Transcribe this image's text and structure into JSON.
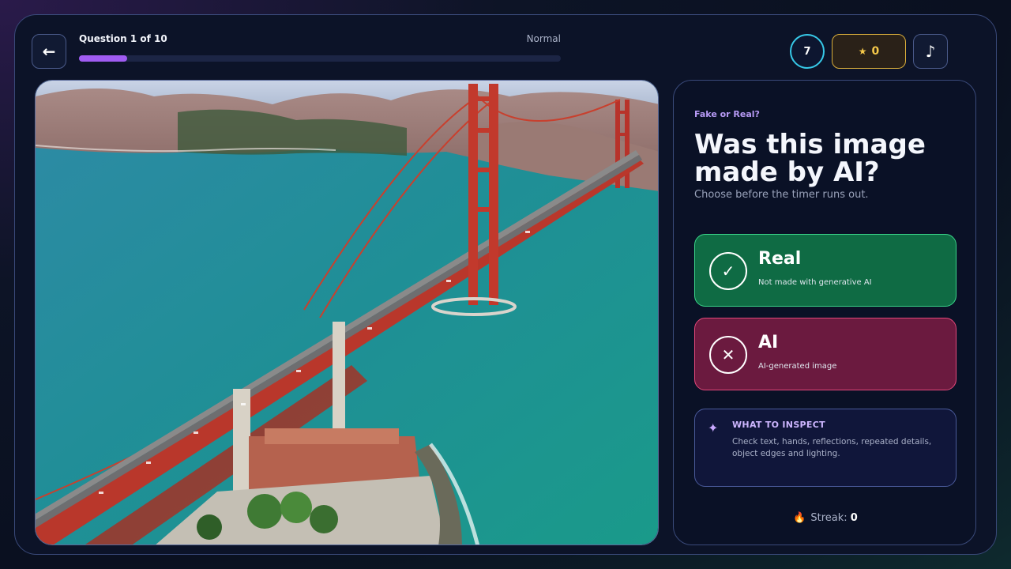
{
  "header": {
    "back_icon": "arrow-left-icon",
    "question_label": "Question 1 of 10",
    "difficulty": "Normal",
    "progress": 0.1,
    "timer": "7",
    "score_icon": "star-icon",
    "score": "0",
    "music_icon": "music-note-icon"
  },
  "image": {
    "subject": "aerial photo of a red suspension bridge over turquoise water"
  },
  "panel": {
    "eyebrow": "Fake or Real?",
    "headline": "Was this image made by AI?",
    "subline": "Choose before the timer runs out.",
    "choices": [
      {
        "title": "Real",
        "desc": "Not made with generative AI",
        "icon": "check-icon",
        "color": "#0f6b44"
      },
      {
        "title": "AI",
        "desc": "AI-generated image",
        "icon": "x-icon",
        "color": "#6b1a3f"
      }
    ],
    "tips": {
      "icon": "sparkle-icon",
      "title": "WHAT TO INSPECT",
      "body": "Check text, hands, reflections, repeated details, object edges and lighting."
    },
    "streak": {
      "icon": "flame-icon",
      "label": "Streak:",
      "value": "0"
    }
  },
  "colors": {
    "accent": "#a05cf2",
    "timer_ring": "#37c9e8",
    "score_border": "#d9ae3b",
    "real": "#3bd58a",
    "ai": "#e3487a"
  }
}
